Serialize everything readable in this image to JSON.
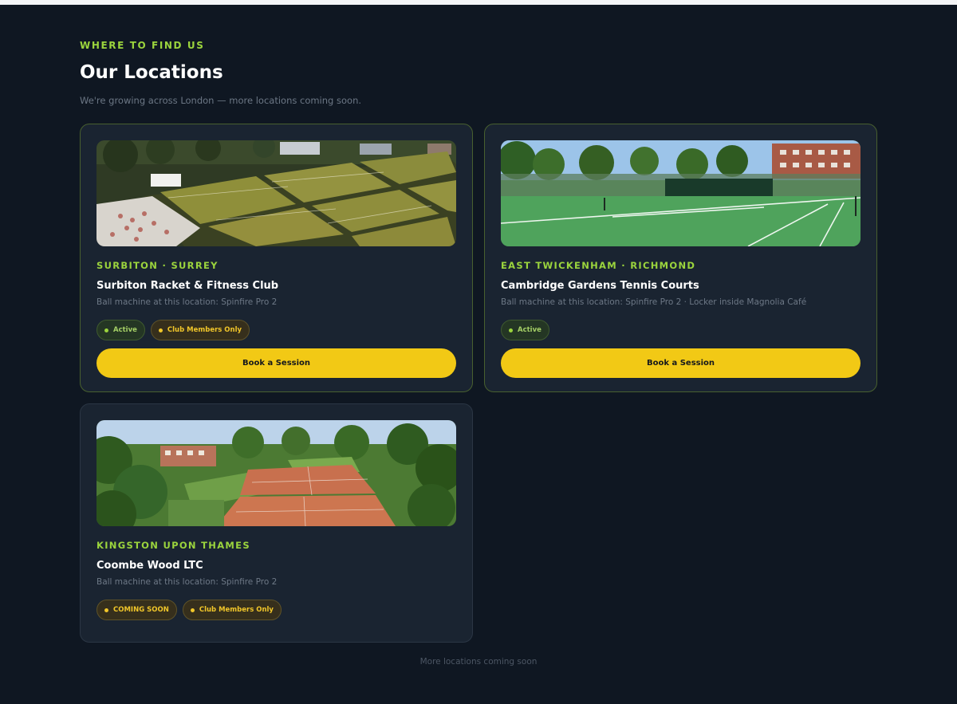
{
  "header": {
    "eyebrow": "WHERE TO FIND US",
    "title": "Our Locations",
    "subtitle": "We're growing across London — more locations coming soon."
  },
  "locations": [
    {
      "area": "SURBITON · SURREY",
      "name": "Surbiton Racket & Fitness Club",
      "machine": "Ball machine at this location: Spinfire Pro 2",
      "badges": [
        "Active",
        "Club Members Only"
      ],
      "button": "Book a Session",
      "photo": "aerial-grass-courts-photo"
    },
    {
      "area": "EAST TWICKENHAM · RICHMOND",
      "name": "Cambridge Gardens Tennis Courts",
      "machine": "Ball machine at this location: Spinfire Pro 2 · Locker inside Magnolia Café",
      "badges": [
        "Active"
      ],
      "button": "Book a Session",
      "photo": "green-hard-court-photo"
    },
    {
      "area": "KINGSTON UPON THAMES",
      "name": "Coombe Wood LTC",
      "machine": "Ball machine at this location: Spinfire Pro 2",
      "badges": [
        "COMING SOON",
        "Club Members Only"
      ],
      "photo": "clay-courts-aerial-photo"
    }
  ],
  "footer": {
    "text": "More locations coming soon"
  },
  "colors": {
    "background": "#0f1722",
    "card": "#1a2431",
    "accent_green": "#9bd43d",
    "accent_yellow": "#f2c915"
  }
}
